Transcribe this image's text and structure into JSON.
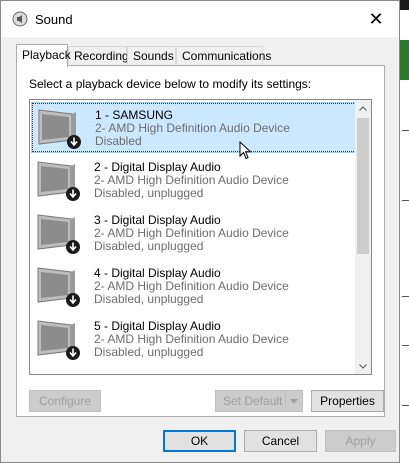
{
  "window": {
    "title": "Sound",
    "close_label": "✕"
  },
  "tabs": [
    {
      "label": "Playback",
      "active": true
    },
    {
      "label": "Recording",
      "active": false
    },
    {
      "label": "Sounds",
      "active": false
    },
    {
      "label": "Communications",
      "active": false
    }
  ],
  "instruction": "Select a playback device below to modify its settings:",
  "devices": [
    {
      "name": "1 - SAMSUNG",
      "description": "2- AMD High Definition Audio Device",
      "status": "Disabled",
      "selected": true
    },
    {
      "name": "2 - Digital Display Audio",
      "description": "2- AMD High Definition Audio Device",
      "status": "Disabled, unplugged",
      "selected": false
    },
    {
      "name": "3 - Digital Display Audio",
      "description": "2- AMD High Definition Audio Device",
      "status": "Disabled, unplugged",
      "selected": false
    },
    {
      "name": "4 - Digital Display Audio",
      "description": "2- AMD High Definition Audio Device",
      "status": "Disabled, unplugged",
      "selected": false
    },
    {
      "name": "5 - Digital Display Audio",
      "description": "2- AMD High Definition Audio Device",
      "status": "Disabled, unplugged",
      "selected": false
    }
  ],
  "panel_buttons": {
    "configure": "Configure",
    "set_default": "Set Default",
    "properties": "Properties"
  },
  "dialog_buttons": {
    "ok": "OK",
    "cancel": "Cancel",
    "apply": "Apply"
  },
  "icons": {
    "device": "monitor-speaker-icon",
    "status_badge": "down-arrow-badge-icon",
    "title": "speaker-icon"
  },
  "colors": {
    "selection_bg": "#cce8ff",
    "selection_border": "#99d1ff",
    "default_button_border": "#0078d7",
    "secondary_text": "#6d6d6d"
  }
}
